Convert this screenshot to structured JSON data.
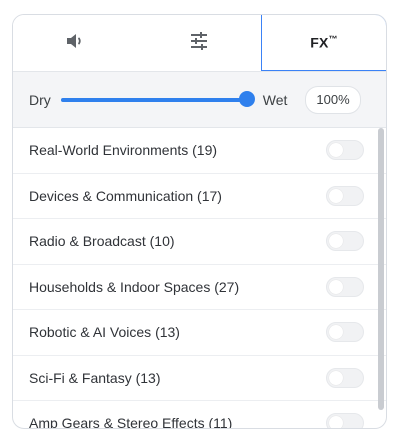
{
  "tabs": {
    "speaker_icon": "speaker-icon",
    "sliders_icon": "sliders-icon",
    "fx_label": "FX",
    "fx_mark": "™"
  },
  "mix": {
    "dry_label": "Dry",
    "wet_label": "Wet",
    "value_text": "100%",
    "value_fraction": 1.0,
    "accent_color": "#2f80ed"
  },
  "effects": [
    {
      "label": "Real-World Environments (19)",
      "enabled": false
    },
    {
      "label": "Devices & Communication (17)",
      "enabled": false
    },
    {
      "label": "Radio & Broadcast (10)",
      "enabled": false
    },
    {
      "label": "Households & Indoor Spaces (27)",
      "enabled": false
    },
    {
      "label": "Robotic & AI Voices (13)",
      "enabled": false
    },
    {
      "label": "Sci-Fi & Fantasy (13)",
      "enabled": false
    },
    {
      "label": "Amp Gears & Stereo Effects (11)",
      "enabled": false
    }
  ]
}
